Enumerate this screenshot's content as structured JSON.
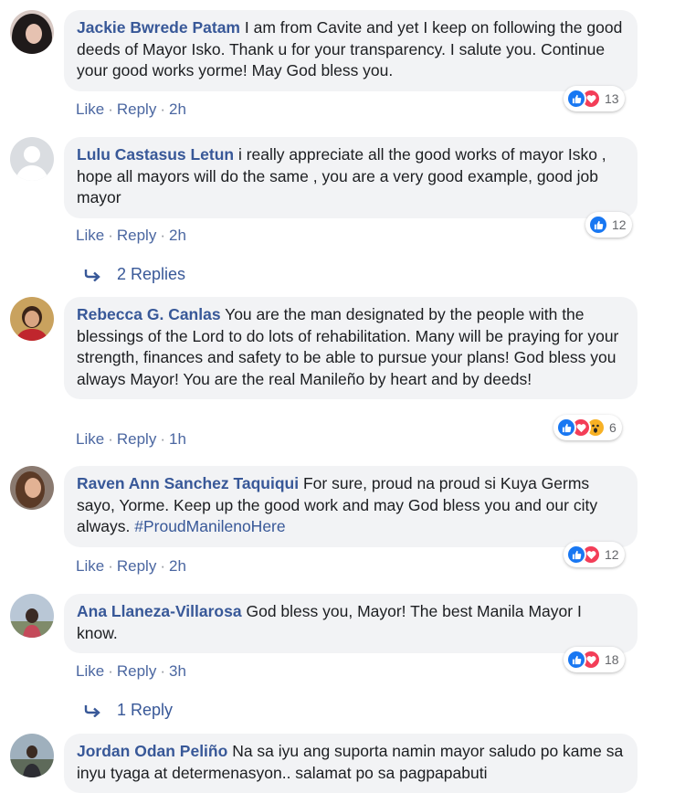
{
  "colors": {
    "link": "#385898",
    "bubble": "#f2f3f5",
    "like": "#1877f2",
    "love": "#f33e58",
    "wow": "#f7b125"
  },
  "comments": [
    {
      "author": "Jackie Bwrede Patam",
      "text": "I am from Cavite and yet I keep on following the good deeds of Mayor Isko. Thank u for your transparency. I salute you. Continue your good works yorme! May God bless you.",
      "like": "Like",
      "reply": "Reply",
      "time": "2h",
      "reactions": [
        "like",
        "love"
      ],
      "count": "13",
      "avatar": "avatar-dark-hair"
    },
    {
      "author": "Lulu Castasus Letun",
      "text": "i really appreciate all the good works of mayor Isko , hope all mayors will do the same , you are a very good example, good job mayor",
      "like": "Like",
      "reply": "Reply",
      "time": "2h",
      "reactions": [
        "like"
      ],
      "count": "12",
      "avatar": "avatar-default-silhouette",
      "replies": "2 Replies"
    },
    {
      "author": "Rebecca G. Canlas",
      "text": "You are the man designated by the people with the blessings of the Lord to do lots of rehabilitation. Many will be praying for your strength, finances and safety to be able to pursue your plans! God bless you always Mayor! You are the real Manileño by heart and by deeds!",
      "like": "Like",
      "reply": "Reply",
      "time": "1h",
      "reactions": [
        "like",
        "love",
        "wow"
      ],
      "count": "6",
      "avatar": "avatar-woman-red"
    },
    {
      "author": "Raven Ann Sanchez Taquiqui",
      "text": "For sure, proud na proud si Kuya Germs sayo, Yorme. Keep up the good work and may God bless you and our city always.",
      "hashtag": "#ProudManilenoHere",
      "like": "Like",
      "reply": "Reply",
      "time": "2h",
      "reactions": [
        "like",
        "love"
      ],
      "count": "12",
      "avatar": "avatar-woman-selfie"
    },
    {
      "author": "Ana Llaneza-Villarosa",
      "text": "God bless you, Mayor! The best Manila Mayor I know.",
      "like": "Like",
      "reply": "Reply",
      "time": "3h",
      "reactions": [
        "like",
        "love"
      ],
      "count": "18",
      "avatar": "avatar-woman-outdoor",
      "replies": "1 Reply"
    },
    {
      "author": "Jordan Odan Peliño",
      "text": "Na sa iyu ang suporta namin mayor saludo po kame sa inyu tyaga at determenasyon.. salamat po sa pagpapabuti",
      "avatar": "avatar-man-outdoor"
    }
  ]
}
